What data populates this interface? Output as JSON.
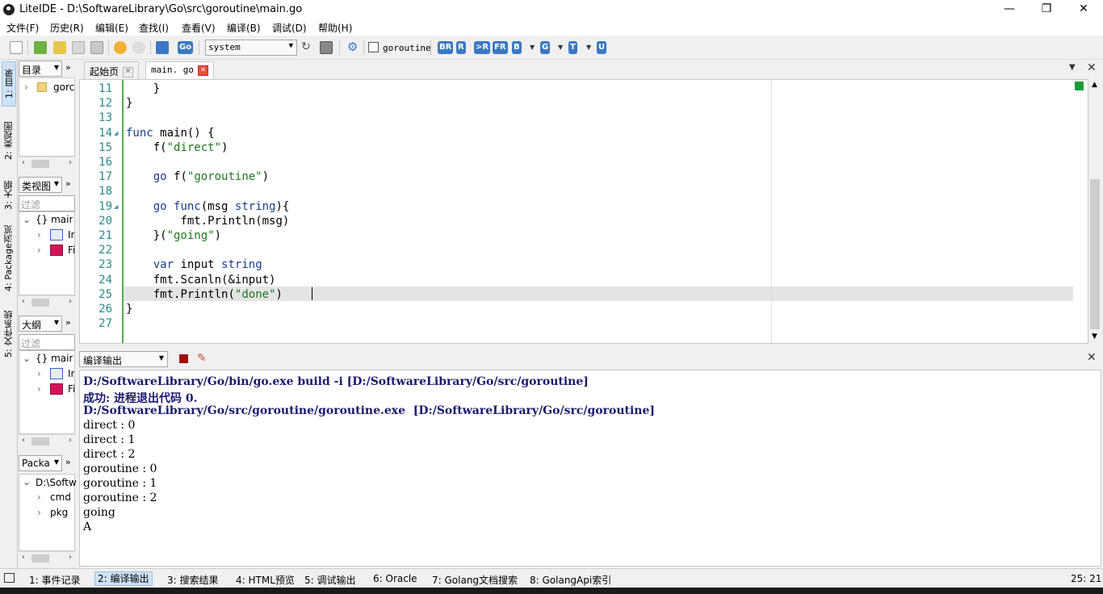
{
  "window": {
    "title": "LiteIDE - D:\\SoftwareLibrary\\Go\\src\\goroutine\\main.go",
    "minimize": "—",
    "restore": "❐",
    "close": "✕"
  },
  "menu": [
    "文件(F)",
    "历史(R)",
    "编辑(E)",
    "查找(I)",
    "查看(V)",
    "编译(B)",
    "调试(D)",
    "帮助(H)"
  ],
  "toolbar": {
    "env": "system",
    "goroutine_checkbox": "goroutine",
    "go_label": "Go",
    "build_buttons": [
      "BR",
      "R",
      ">R",
      "FR",
      "B",
      "G",
      "T",
      "U"
    ]
  },
  "sidetabs": [
    "1: 目录",
    "2: 类视图",
    "3: 大纲",
    "4: Package浏览",
    "5: 文件系统"
  ],
  "panels": {
    "dir": {
      "select": "目录",
      "more": "»",
      "items": [
        "gorc"
      ]
    },
    "classview": {
      "select": "类视图",
      "more": "»",
      "filter": "过滤",
      "root": "{} mair",
      "children": [
        "Ir",
        "Fi"
      ]
    },
    "outline": {
      "select": "大纲",
      "more": "»",
      "filter": "过滤",
      "root": "{} mair",
      "children": [
        "Ir",
        "Fi"
      ]
    },
    "package": {
      "select": "Packa",
      "more": "»",
      "root": "D:\\Softw",
      "children": [
        "cmd",
        "pkg"
      ]
    }
  },
  "editor_tabs": [
    {
      "label": "起始页",
      "close": "✕"
    },
    {
      "label": "main. go",
      "close": "✕"
    }
  ],
  "editor": {
    "line_numbers": [
      "11",
      "12",
      "13",
      "14",
      "15",
      "16",
      "17",
      "18",
      "19",
      "20",
      "21",
      "22",
      "23",
      "24",
      "25",
      "26",
      "27"
    ],
    "lines": [
      "    }",
      "}",
      "",
      "func main() {",
      "    f(\"direct\")",
      "",
      "    go f(\"goroutine\")",
      "",
      "    go func(msg string){",
      "        fmt.Println(msg)",
      "    }(\"going\")",
      "",
      "    var input string",
      "    fmt.Scanln(&input)",
      "    fmt.Println(\"done\")",
      "}",
      ""
    ]
  },
  "output": {
    "select": "编译输出",
    "lines": [
      "D:/SoftwareLibrary/Go/bin/go.exe build -i [D:/SoftwareLibrary/Go/src/goroutine]",
      "成功: 进程退出代码 0.",
      "D:/SoftwareLibrary/Go/src/goroutine/goroutine.exe  [D:/SoftwareLibrary/Go/src/goroutine]",
      "direct : 0",
      "direct : 1",
      "direct : 2",
      "goroutine : 0",
      "goroutine : 1",
      "goroutine : 2",
      "going",
      "A"
    ]
  },
  "statusbar": {
    "tabs": [
      "1: 事件记录",
      "2: 编译输出",
      "3: 搜索结果",
      "4: HTML预览",
      "5: 调试输出",
      "6: Oracle",
      "7: Golang文档搜索",
      "8: GolangApi索引"
    ],
    "position": "25: 21"
  }
}
